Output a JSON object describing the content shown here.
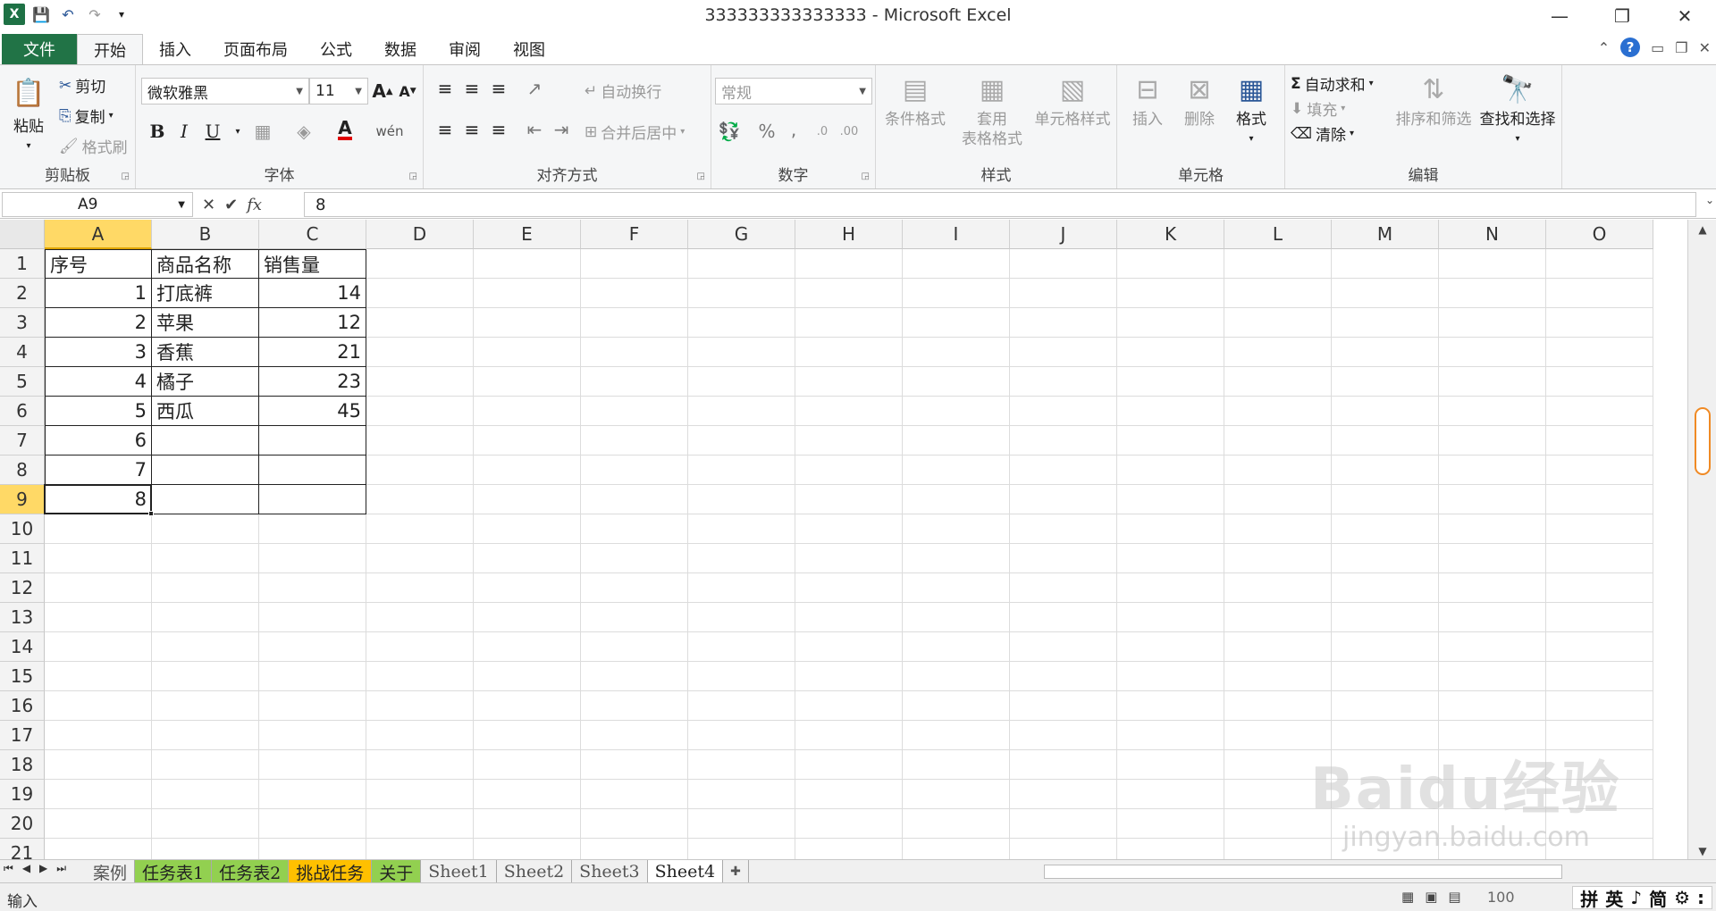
{
  "window": {
    "title": "333333333333333 - Microsoft Excel",
    "minimize": "—",
    "restore": "❐",
    "close": "✕"
  },
  "ribbon_tabs": {
    "file": "文件",
    "items": [
      "开始",
      "插入",
      "页面布局",
      "公式",
      "数据",
      "审阅",
      "视图"
    ],
    "active": "开始"
  },
  "clipboard": {
    "paste": "粘贴",
    "cut": "剪切",
    "copy": "复制",
    "format_painter": "格式刷",
    "label": "剪贴板"
  },
  "font": {
    "name": "微软雅黑",
    "size": "11",
    "bold": "B",
    "italic": "I",
    "underline": "U",
    "grow": "A",
    "shrink": "A",
    "color_glyph": "A",
    "font_color": "#e00000",
    "wen": "wén",
    "label": "字体"
  },
  "alignment": {
    "wrap_text": "自动换行",
    "merge_center": "合并后居中",
    "label": "对齐方式"
  },
  "number": {
    "format": "常规",
    "percent": "%",
    "comma": ",",
    "label": "数字"
  },
  "styles": {
    "conditional": "条件格式",
    "table_line1": "套用",
    "table_line2": "表格格式",
    "cell_styles": "单元格样式",
    "label": "样式"
  },
  "cells_group": {
    "insert": "插入",
    "delete": "删除",
    "format": "格式",
    "label": "单元格"
  },
  "editing": {
    "autosum": "自动求和",
    "fill": "填充",
    "clear": "清除",
    "sort_filter": "排序和筛选",
    "find_select": "查找和选择",
    "label": "编辑"
  },
  "formula_bar": {
    "name_box": "A9",
    "formula": "8",
    "fx": "fx"
  },
  "sheet": {
    "columns": [
      "A",
      "B",
      "C",
      "D",
      "E",
      "F",
      "G",
      "H",
      "I",
      "J",
      "K",
      "L",
      "M",
      "N",
      "O"
    ],
    "rows": [
      "1",
      "2",
      "3",
      "4",
      "5",
      "6",
      "7",
      "8",
      "9",
      "10",
      "11",
      "12",
      "13",
      "14",
      "15",
      "16",
      "17",
      "18",
      "19",
      "20",
      "21"
    ],
    "selected_column": "A",
    "selected_row": "9",
    "data": [
      [
        "序号",
        "商品名称",
        "销售量"
      ],
      [
        "1",
        "打底裤",
        "14"
      ],
      [
        "2",
        "苹果",
        "12"
      ],
      [
        "3",
        "香蕉",
        "21"
      ],
      [
        "4",
        "橘子",
        "23"
      ],
      [
        "5",
        "西瓜",
        "45"
      ],
      [
        "6",
        "",
        ""
      ],
      [
        "7",
        "",
        ""
      ],
      [
        "8",
        "",
        ""
      ]
    ]
  },
  "sheet_tabs": [
    {
      "name": "案例",
      "color": ""
    },
    {
      "name": "任务表1",
      "color": "#92d050"
    },
    {
      "name": "任务表2",
      "color": "#92d050"
    },
    {
      "name": "挑战任务",
      "color": "#ffc000"
    },
    {
      "name": "关于",
      "color": "#92d050"
    },
    {
      "name": "Sheet1",
      "color": ""
    },
    {
      "name": "Sheet2",
      "color": ""
    },
    {
      "name": "Sheet3",
      "color": ""
    },
    {
      "name": "Sheet4",
      "color": ""
    }
  ],
  "status_bar": {
    "mode": "输入",
    "zoom": "100",
    "ime": [
      "拼",
      "英",
      "♪",
      "简",
      "⚙",
      ":"
    ]
  },
  "watermark": {
    "brand": "Baidu经验",
    "url": "jingyan.baidu.com"
  }
}
